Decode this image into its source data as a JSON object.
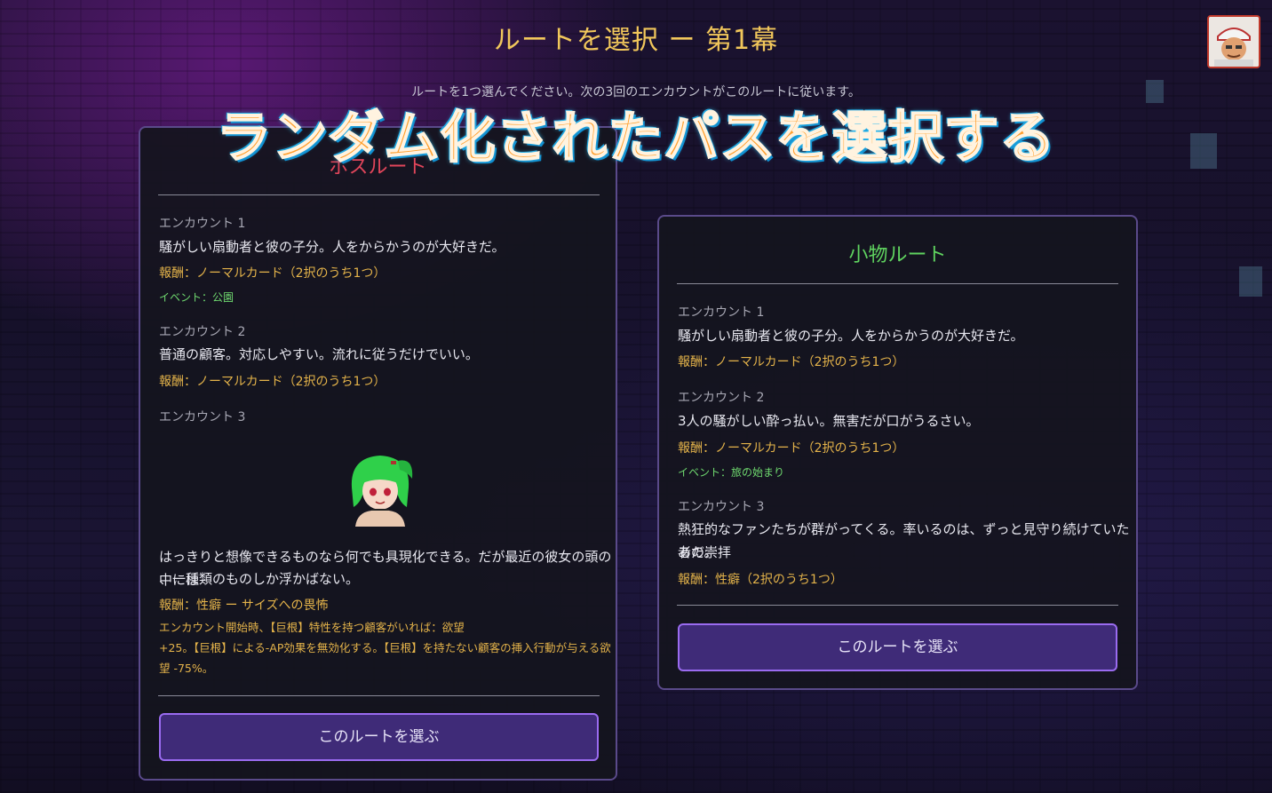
{
  "header": {
    "title": "ルートを選択 ー 第1幕",
    "subtitle": "ルートを1つ選んでください。次の3回のエンカウントがこのルートに従います。"
  },
  "overlay_banner": "ランダム化されたパスを選択する",
  "avatar_icon": "player-portrait-icon",
  "routes": [
    {
      "name": "ボスルート",
      "name_color": "#e0455a",
      "encounters": [
        {
          "label": "エンカウント 1",
          "description": "騒がしい扇動者と彼の子分。人をからかうのが大好きだ。",
          "reward": "報酬：ノーマルカード（2択のうち1つ）",
          "event": "イベント：公園"
        },
        {
          "label": "エンカウント 2",
          "description": "普通の顧客。対応しやすい。流れに従うだけでいい。",
          "reward": "報酬：ノーマルカード（2択のうち1つ）"
        },
        {
          "label": "エンカウント 3",
          "portrait_icon": "green-haired-boss-portrait-icon",
          "description_line1": "はっきりと想像できるものなら何でも具現化できる。だが最近の彼女の頭の中には",
          "description_line2": "、一種類のものしか浮かばない。",
          "reward": "報酬：性癖 ー サイズへの畏怖",
          "effect_line1": "エンカウント開始時、【巨根】特性を持つ顧客がいれば：欲望",
          "effect_line2": "+25。【巨根】による-AP効果を無効化する。【巨根】を持たない顧客の挿入行動が与える欲",
          "effect_line3": "望 -75%。"
        }
      ],
      "button": "このルートを選ぶ"
    },
    {
      "name": "小物ルート",
      "name_color": "#5fd35f",
      "encounters": [
        {
          "label": "エンカウント 1",
          "description": "騒がしい扇動者と彼の子分。人をからかうのが大好きだ。",
          "reward": "報酬：ノーマルカード（2択のうち1つ）"
        },
        {
          "label": "エンカウント 2",
          "description": "3人の騒がしい酔っ払い。無害だが口がうるさい。",
          "reward": "報酬：ノーマルカード（2択のうち1つ）",
          "event": "イベント：旅の始まり"
        },
        {
          "label": "エンカウント 3",
          "description_line1": "熱狂的なファンたちが群がってくる。率いるのは、ずっと見守り続けていたあの崇拝",
          "description_line2": "者だ。",
          "reward": "報酬：性癖（2択のうち1つ）"
        }
      ],
      "button": "このルートを選ぶ"
    }
  ]
}
